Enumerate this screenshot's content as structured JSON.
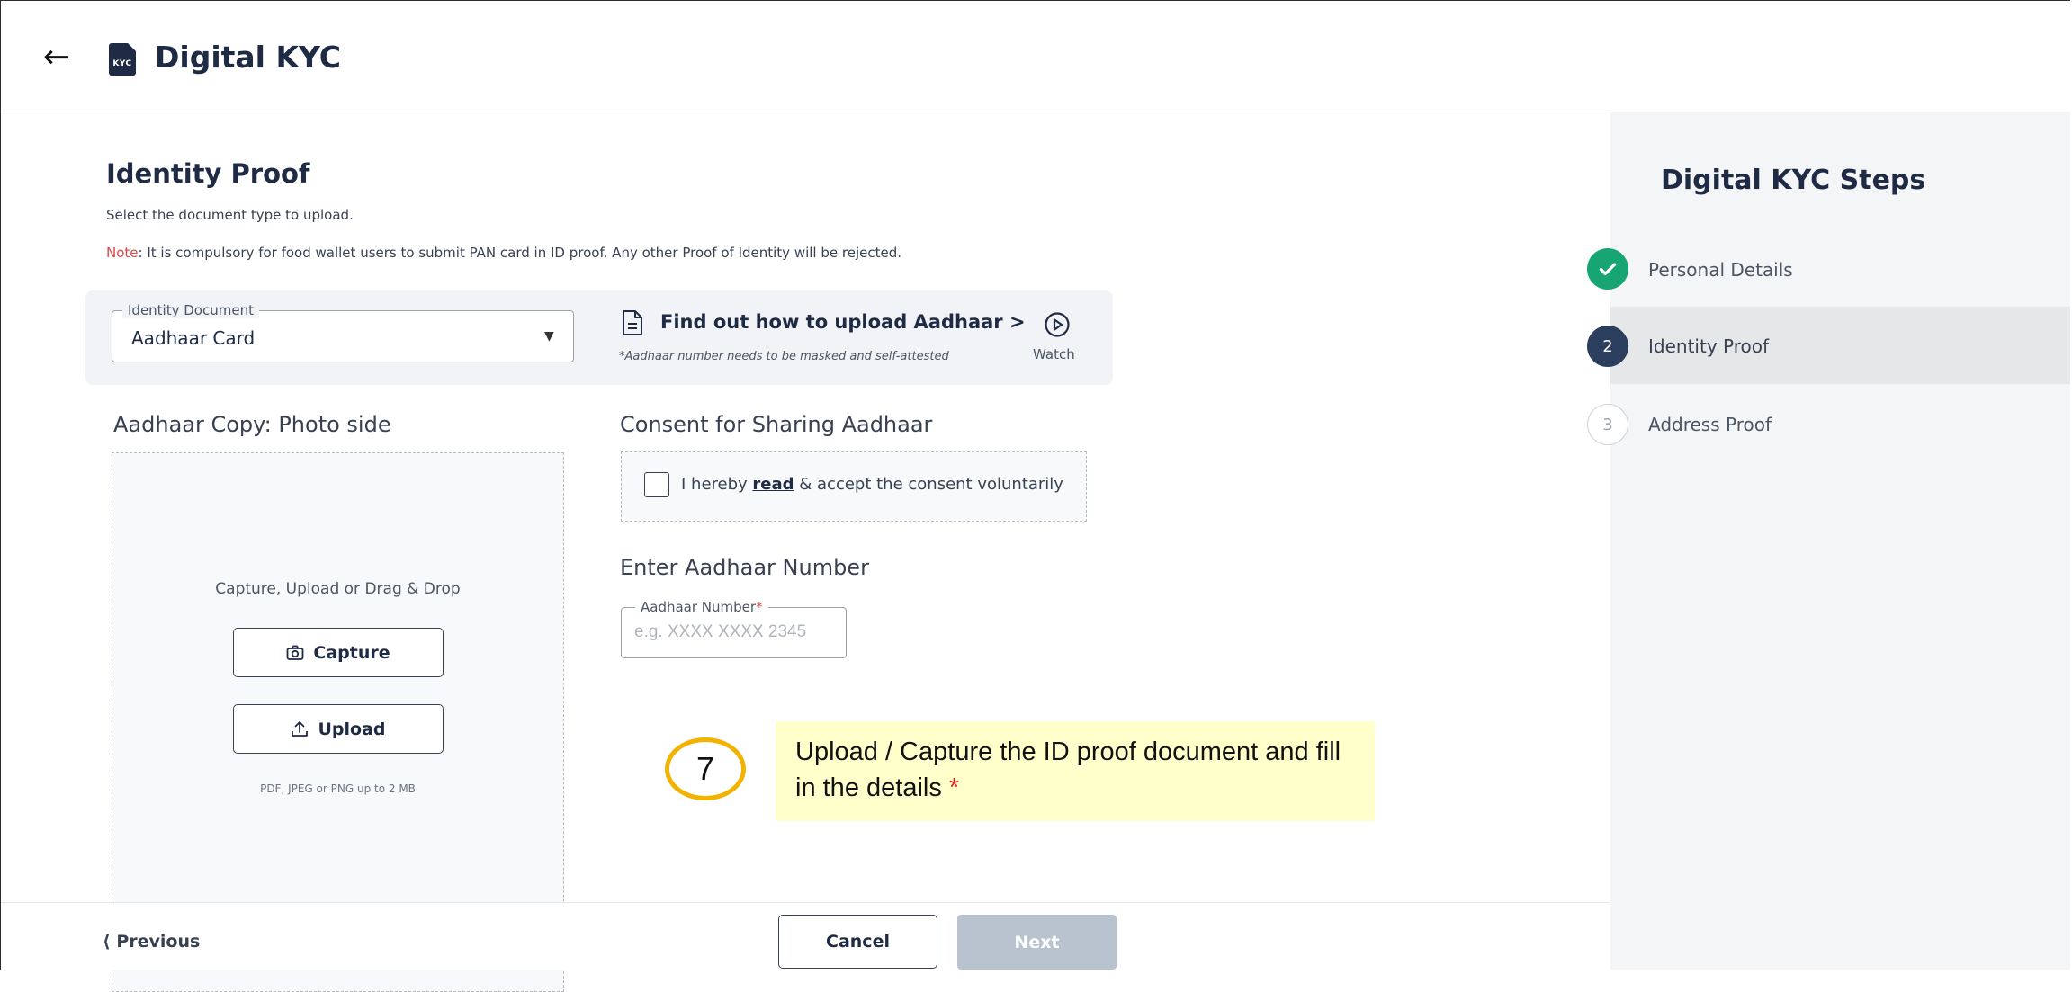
{
  "header": {
    "back_icon": "arrow-left-icon",
    "logo_text": "KYC",
    "title": "Digital KYC"
  },
  "section": {
    "title": "Identity Proof",
    "subtitle": "Select the document type to upload.",
    "note_label": "Note",
    "note_text": ": It is compulsory for food wallet users to submit PAN card in ID proof. Any other Proof of Identity will be rejected."
  },
  "identity_document": {
    "label": "Identity Document",
    "selected": "Aadhaar Card"
  },
  "help": {
    "link_text": "Find out how to upload Aadhaar >",
    "note": "*Aadhaar number needs to be masked and self-attested",
    "watch_label": "Watch"
  },
  "upload": {
    "heading": "Aadhaar Copy: Photo side",
    "drop_hint": "Capture, Upload or Drag & Drop",
    "capture_label": "Capture",
    "upload_label": "Upload",
    "limits": "PDF, JPEG or PNG up to 2 MB"
  },
  "consent": {
    "heading": "Consent for Sharing Aadhaar",
    "text_before": "I hereby ",
    "link": "read",
    "text_after": " & accept the consent voluntarily",
    "checked": false
  },
  "aadhaar_number": {
    "heading": "Enter Aadhaar Number",
    "label": "Aadhaar Number",
    "required_mark": "*",
    "placeholder": "e.g. XXXX XXXX 2345",
    "value": ""
  },
  "annotation": {
    "step": "7",
    "text": "Upload / Capture the ID proof document and fill in the details",
    "asterisk": "*"
  },
  "steps": {
    "title": "Digital KYC Steps",
    "items": [
      {
        "number": "",
        "label": "Personal Details",
        "status": "done"
      },
      {
        "number": "2",
        "label": "Identity Proof",
        "status": "current"
      },
      {
        "number": "3",
        "label": "Address Proof",
        "status": "pending"
      }
    ]
  },
  "footer": {
    "previous": "Previous",
    "cancel": "Cancel",
    "next": "Next"
  },
  "colors": {
    "brand_navy": "#1f2a44",
    "success": "#17a673",
    "note_red": "#e04848",
    "next_disabled": "#b9c3cf",
    "callout_bg": "#ffffcc",
    "badge_ring": "#f2b300"
  }
}
